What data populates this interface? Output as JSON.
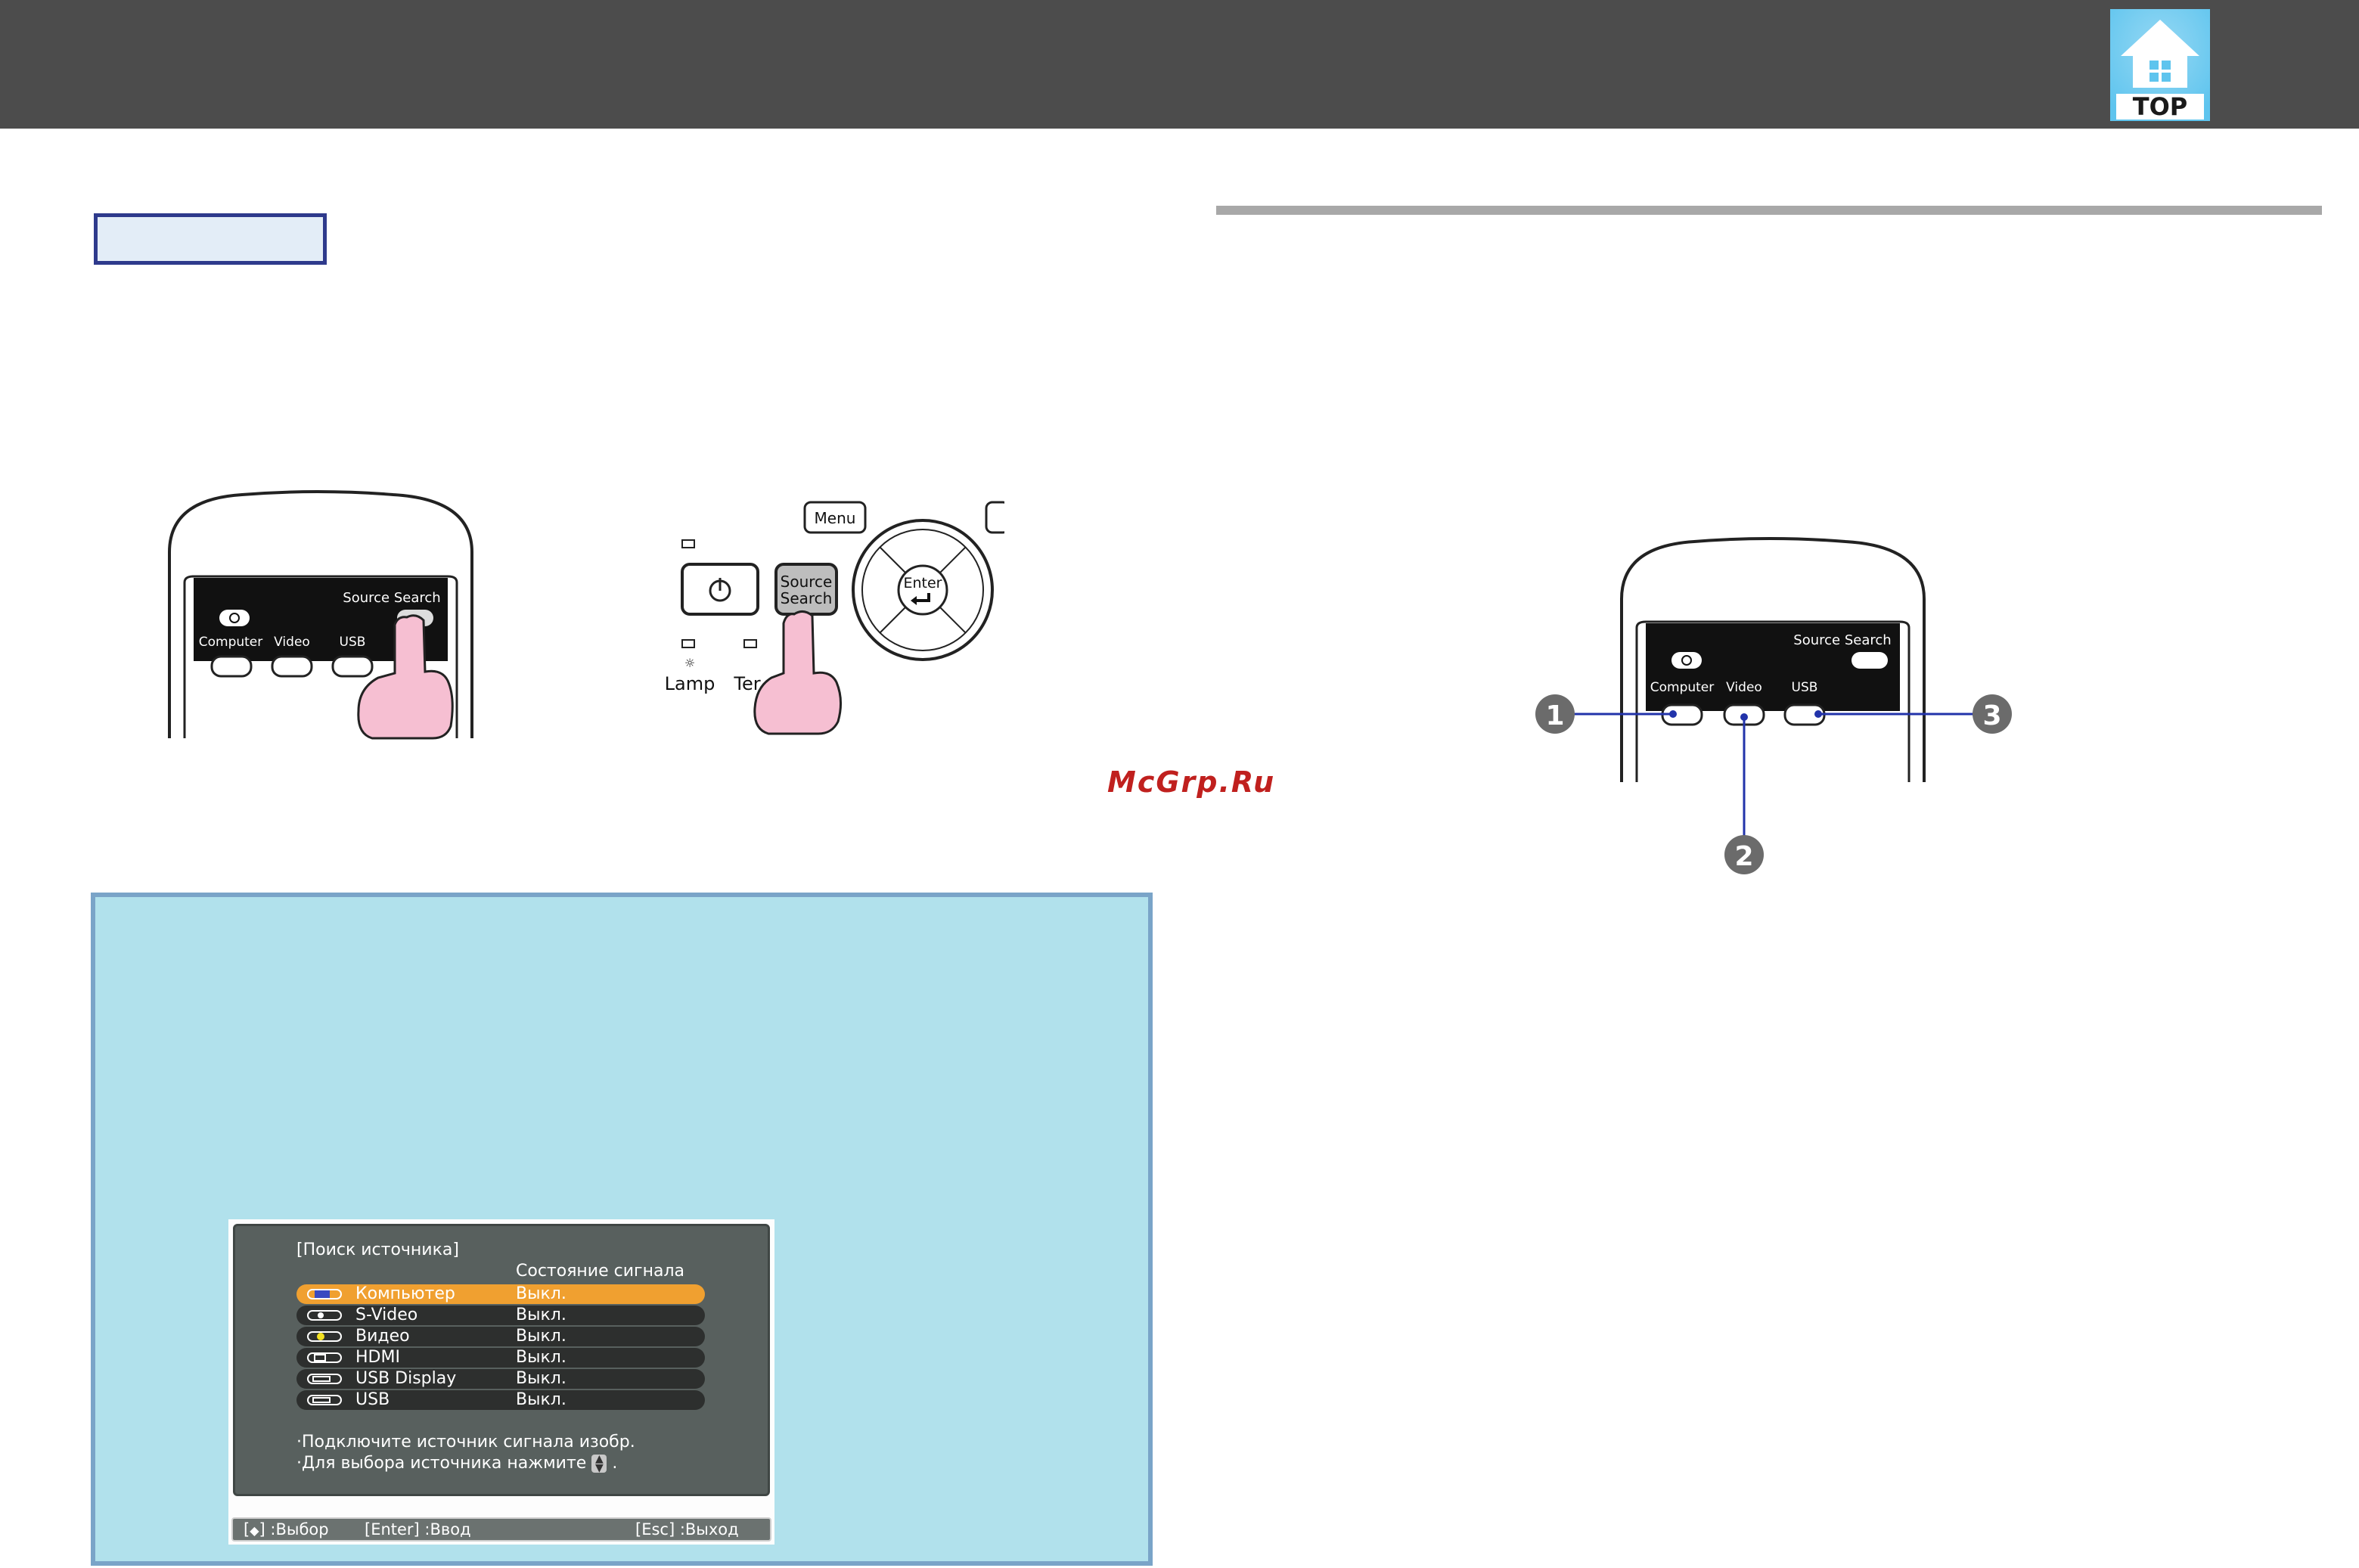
{
  "header": {
    "top_button": {
      "label": "TOP",
      "icon": "home-icon",
      "bg": "#5ec4ee"
    }
  },
  "left_remote": {
    "source_search_label": "Source Search",
    "buttons": [
      "Computer",
      "Video",
      "USB"
    ]
  },
  "control_panel": {
    "menu_label": "Menu",
    "source_search_label_1": "Source",
    "source_search_label_2": "Search",
    "enter_label": "Enter",
    "lamp_label": "Lamp",
    "temp_label": "Ter"
  },
  "right_remote": {
    "source_search_label": "Source Search",
    "buttons": [
      "Computer",
      "Video",
      "USB"
    ],
    "callouts": [
      "1",
      "2",
      "3"
    ]
  },
  "watermark": "McGrp.Ru",
  "osd": {
    "title": "[Поиск источника]",
    "status_header": "Состояние сигнала",
    "rows": [
      {
        "name": "Компьютер",
        "state": "Выкл.",
        "selected": true
      },
      {
        "name": "S-Video",
        "state": "Выкл.",
        "selected": false
      },
      {
        "name": "Видео",
        "state": "Выкл.",
        "selected": false
      },
      {
        "name": "HDMI",
        "state": "Выкл.",
        "selected": false
      },
      {
        "name": "USB Display",
        "state": "Выкл.",
        "selected": false
      },
      {
        "name": "USB",
        "state": "Выкл.",
        "selected": false
      }
    ],
    "hint_1": "·Подключите источник сигнала изобр.",
    "hint_2": "·Для выбора источника нажмите",
    "hint_2_end": ".",
    "footer": {
      "select": ":Выбор",
      "enter": "[Enter] :Ввод",
      "exit": "[Esc] :Выход"
    }
  },
  "colors": {
    "header": "#4c4c4c",
    "note_bg": "#b1e1ec",
    "selected_row": "#f0a030"
  }
}
